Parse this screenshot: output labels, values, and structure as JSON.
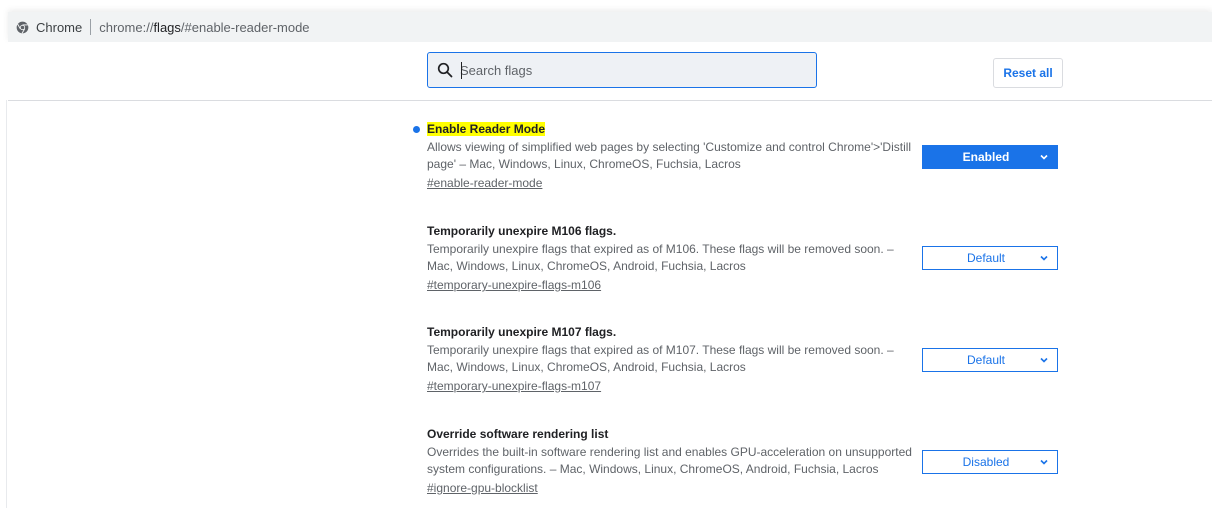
{
  "omnibox": {
    "chip": "Chrome",
    "url_prefix": "chrome://",
    "url_host": "flags",
    "url_path": "/#enable-reader-mode"
  },
  "search": {
    "placeholder": "Search flags",
    "value": ""
  },
  "toolbar": {
    "reset_label": "Reset all"
  },
  "colors": {
    "accent": "#1a73e8",
    "highlight": "#ffff00",
    "text_secondary": "#5f6368"
  },
  "flags": [
    {
      "title": "Enable Reader Mode",
      "description": "Allows viewing of simplified web pages by selecting 'Customize and control Chrome'>'Distill page' – Mac, Windows, Linux, ChromeOS, Fuchsia, Lacros",
      "link": "#enable-reader-mode",
      "state": "Enabled",
      "modified": true
    },
    {
      "title": "Temporarily unexpire M106 flags.",
      "description": "Temporarily unexpire flags that expired as of M106. These flags will be removed soon. – Mac, Windows, Linux, ChromeOS, Android, Fuchsia, Lacros",
      "link": "#temporary-unexpire-flags-m106",
      "state": "Default",
      "modified": false
    },
    {
      "title": "Temporarily unexpire M107 flags.",
      "description": "Temporarily unexpire flags that expired as of M107. These flags will be removed soon. – Mac, Windows, Linux, ChromeOS, Android, Fuchsia, Lacros",
      "link": "#temporary-unexpire-flags-m107",
      "state": "Default",
      "modified": false
    },
    {
      "title": "Override software rendering list",
      "description": "Overrides the built-in software rendering list and enables GPU-acceleration on unsupported system configurations. – Mac, Windows, Linux, ChromeOS, Android, Fuchsia, Lacros",
      "link": "#ignore-gpu-blocklist",
      "state": "Disabled",
      "modified": false
    }
  ]
}
